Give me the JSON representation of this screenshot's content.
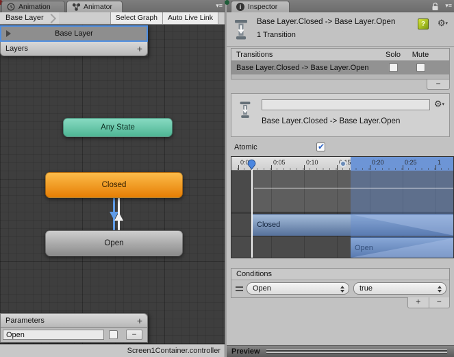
{
  "icons": {
    "check": "✔",
    "menu": "▾≡",
    "gear": "⚙",
    "gear_drop": "▾",
    "plus": "+",
    "minus": "−",
    "help": "?",
    "info": "i"
  },
  "colors": {
    "selection_blue": "#4f8ee0",
    "timeline_blue": "#6d95d6",
    "state_teal": "#5fc3a2",
    "state_orange": "#f09213",
    "state_gray": "#aaaaaa",
    "transition_bar_blue": "#7795bc"
  },
  "animator": {
    "tabs": {
      "animation": "Animation",
      "animator": "Animator"
    },
    "toolbar": {
      "breadcrumb": "Base Layer",
      "select_graph": "Select Graph",
      "auto_live_link": "Auto Live Link"
    },
    "layers": {
      "selected": "Base Layer",
      "header": "Layers"
    },
    "graph": {
      "any_state": "Any State",
      "closed": "Closed",
      "open": "Open"
    },
    "parameters": {
      "header": "Parameters",
      "param_name": "Open"
    },
    "status": "Screen1Container.controller"
  },
  "inspector": {
    "tab": "Inspector",
    "header": {
      "title": "Base Layer.Closed -> Base Layer.Open",
      "subtitle": "1 Transition"
    },
    "transitions": {
      "header": "Transitions",
      "solo": "Solo",
      "mute": "Mute",
      "row": "Base Layer.Closed -> Base Layer.Open"
    },
    "detail": {
      "name_value": "",
      "label": "Base Layer.Closed -> Base Layer.Open"
    },
    "atomic_label": "Atomic",
    "timeline": {
      "ticks": [
        "0:00",
        "0:05",
        "0:10",
        "0:15",
        "0:20",
        "0:25",
        "1"
      ],
      "closed_bar": "Closed",
      "open_bar": "Open"
    },
    "conditions": {
      "header": "Conditions",
      "parameter": "Open",
      "value": "true"
    },
    "preview": "Preview"
  }
}
